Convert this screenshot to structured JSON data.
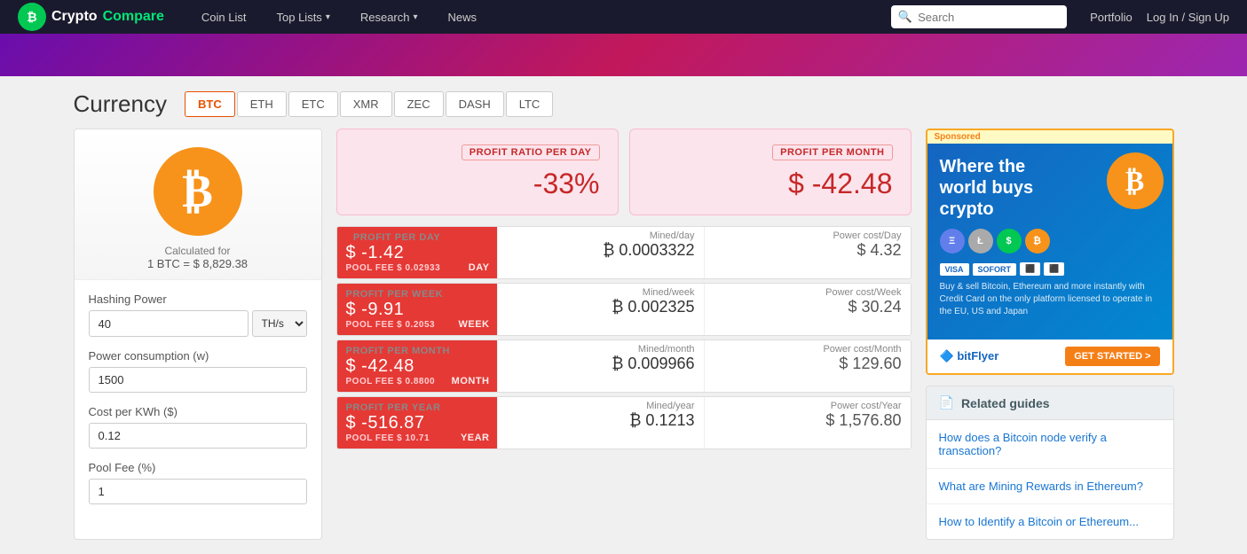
{
  "navbar": {
    "brand": {
      "name_crypto": "Crypto",
      "name_compare": "Compare"
    },
    "links": [
      {
        "label": "Coin List",
        "id": "coin-list",
        "has_arrow": false
      },
      {
        "label": "Top Lists",
        "id": "top-lists",
        "has_arrow": true
      },
      {
        "label": "Research",
        "id": "research",
        "has_arrow": true
      },
      {
        "label": "News",
        "id": "news",
        "has_arrow": false
      }
    ],
    "search_placeholder": "Search",
    "portfolio_label": "Portfolio",
    "login_label": "Log In / Sign Up"
  },
  "currency": {
    "title": "Currency",
    "calculated_label": "Calculated for",
    "calculated_value": "1 BTC = $ 8,829.38",
    "tabs": [
      {
        "label": "BTC",
        "id": "btc",
        "active": true
      },
      {
        "label": "ETH",
        "id": "eth",
        "active": false
      },
      {
        "label": "ETC",
        "id": "etc",
        "active": false
      },
      {
        "label": "XMR",
        "id": "xmr",
        "active": false
      },
      {
        "label": "ZEC",
        "id": "zec",
        "active": false
      },
      {
        "label": "DASH",
        "id": "dash",
        "active": false
      },
      {
        "label": "LTC",
        "id": "ltc",
        "active": false
      }
    ]
  },
  "form": {
    "hashing_power_label": "Hashing Power",
    "hashing_power_value": "40",
    "hashing_power_unit": "TH/s",
    "power_consumption_label": "Power consumption (w)",
    "power_consumption_value": "1500",
    "cost_per_kwh_label": "Cost per KWh ($)",
    "cost_per_kwh_value": "0.12",
    "pool_fee_label": "Pool Fee (%)",
    "pool_fee_value": "1"
  },
  "profit_summary": {
    "day_label": "PROFIT RATIO PER DAY",
    "day_value": "-33%",
    "month_label": "PROFIT PER MONTH",
    "month_value": "$ -42.48"
  },
  "detail_rows": [
    {
      "period": "Day",
      "profit_label": "Profit per day",
      "profit_value": "$ -1.42",
      "pool_fee": "Pool Fee $ 0.02933",
      "mined_label": "Mined/day",
      "mined_value": "₿ 0.0003322",
      "power_label": "Power cost/Day",
      "power_value": "$ 4.32"
    },
    {
      "period": "Week",
      "profit_label": "Profit per week",
      "profit_value": "$ -9.91",
      "pool_fee": "Pool Fee $ 0.2053",
      "mined_label": "Mined/week",
      "mined_value": "₿ 0.002325",
      "power_label": "Power cost/Week",
      "power_value": "$ 30.24"
    },
    {
      "period": "Month",
      "profit_label": "Profit per month",
      "profit_value": "$ -42.48",
      "pool_fee": "Pool Fee $ 0.8800",
      "mined_label": "Mined/month",
      "mined_value": "₿ 0.009966",
      "power_label": "Power cost/Month",
      "power_value": "$ 129.60"
    },
    {
      "period": "Year",
      "profit_label": "Profit per year",
      "profit_value": "$ -516.87",
      "pool_fee": "Pool Fee $ 10.71",
      "mined_label": "Mined/year",
      "mined_value": "₿ 0.1213",
      "power_label": "Power cost/Year",
      "power_value": "$ 1,576.80"
    }
  ],
  "ad": {
    "sponsored_label": "Sponsored",
    "title": "Where the world buys crypto",
    "payment_badges": [
      "VISA",
      "SOFORT"
    ],
    "description": "Buy & sell Bitcoin, Ethereum and more instantly with Credit Card on the only platform licensed to operate in the EU, US and Japan",
    "brand_label": "bitFlyer",
    "cta_label": "GET STARTED >"
  },
  "guides": {
    "header_label": "Related guides",
    "items": [
      {
        "label": "How does a Bitcoin node verify a transaction?"
      },
      {
        "label": "What are Mining Rewards in Ethereum?"
      },
      {
        "label": "How to Identify a Bitcoin or Ethereum..."
      }
    ]
  }
}
